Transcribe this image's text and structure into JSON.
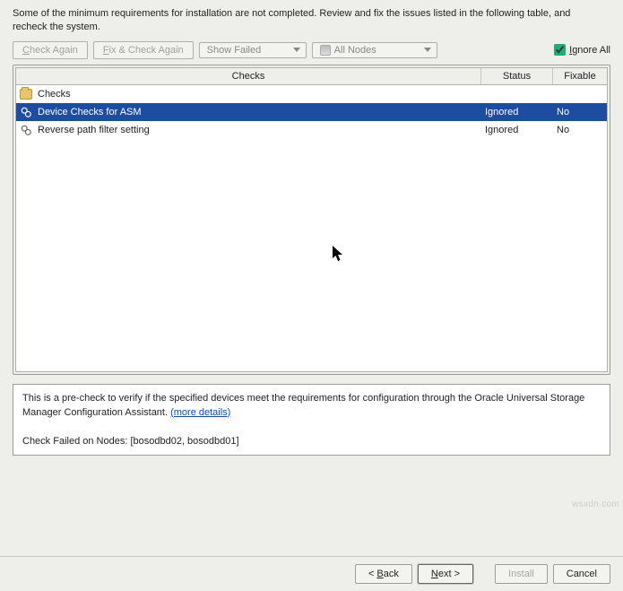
{
  "intro": "Some of the minimum requirements for installation are not completed. Review and fix the issues listed in the following table, and recheck the system.",
  "toolbar": {
    "check_again": "Check Again",
    "fix_check_again": "Fix & Check Again",
    "show_failed": "Show Failed",
    "all_nodes": "All Nodes",
    "ignore_all": "Ignore All",
    "ignore_all_checked": true
  },
  "table": {
    "headers": {
      "checks": "Checks",
      "status": "Status",
      "fixable": "Fixable"
    },
    "root": {
      "label": "Checks"
    },
    "rows": [
      {
        "label": "Device Checks for ASM",
        "status": "Ignored",
        "fixable": "No",
        "selected": true
      },
      {
        "label": "Reverse path filter setting",
        "status": "Ignored",
        "fixable": "No",
        "selected": false
      }
    ]
  },
  "details": {
    "text_line1": "This is a pre-check to verify if the specified devices meet the requirements for configuration through the Oracle Universal Storage Manager Configuration Assistant. ",
    "more_details": "(more details)",
    "failed_nodes": "Check Failed on Nodes: [bosodbd02, bosodbd01]"
  },
  "footer": {
    "back": "< Back",
    "next": "Next >",
    "install": "Install",
    "cancel": "Cancel"
  },
  "watermark": "wsxdn.com"
}
